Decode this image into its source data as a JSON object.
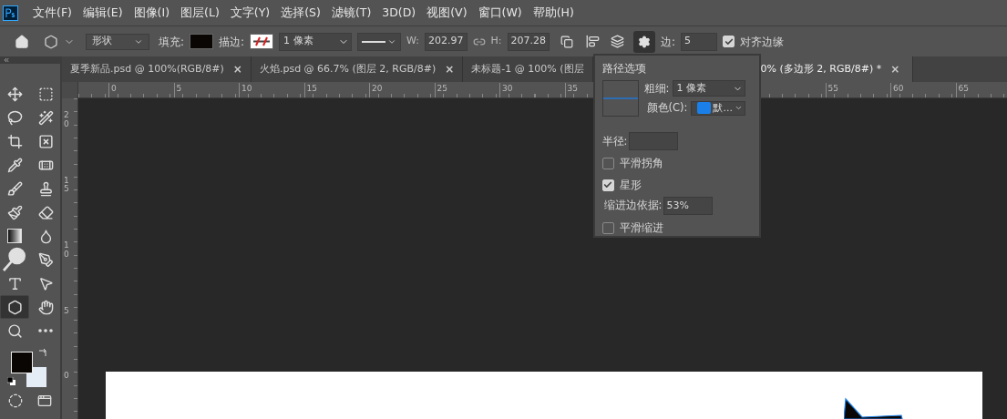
{
  "menu": [
    "文件(F)",
    "编辑(E)",
    "图像(I)",
    "图层(L)",
    "文字(Y)",
    "选择(S)",
    "滤镜(T)",
    "3D(D)",
    "视图(V)",
    "窗口(W)",
    "帮助(H)"
  ],
  "options_bar": {
    "mode": "形状",
    "fill_label": "填充:",
    "stroke_label": "描边:",
    "stroke_width": "1 像素",
    "w_label": "W:",
    "w_value": "202.97",
    "h_label": "H:",
    "h_value": "207.28",
    "sides_label": "边:",
    "sides_value": "5",
    "align_edges": {
      "label": "对齐边缘",
      "checked": true
    }
  },
  "tabs": [
    {
      "label": "夏季新品.psd @ 100%(RGB/8#)",
      "selected": false,
      "close": "×"
    },
    {
      "label": "火焰.psd @ 66.7% (图层 2, RGB/8#)",
      "selected": false,
      "close": "×"
    },
    {
      "label": "未标题-1 @ 100% (图层",
      "selected": false
    },
    {
      "label": "0% (多边形 2, RGB/8#) *",
      "selected": true,
      "close": "×"
    }
  ],
  "ruler_h": [
    "0",
    "5",
    "10",
    "15",
    "20",
    "25",
    "30",
    "35",
    "55",
    "60",
    "65"
  ],
  "ruler_v": [
    "20",
    "15",
    "10",
    "5",
    "0"
  ],
  "tools": [
    {
      "selected": false
    },
    {
      "selected": false
    },
    {
      "selected": false
    },
    {
      "selected": false
    },
    {
      "selected": false
    },
    {
      "selected": false
    },
    {
      "selected": false
    },
    {
      "selected": false
    },
    {
      "selected": false
    },
    {
      "selected": false
    },
    {
      "selected": false
    },
    {
      "selected": false
    },
    {
      "selected": false
    },
    {
      "selected": false
    },
    {
      "selected": false
    },
    {
      "selected": false
    },
    {
      "selected": false
    },
    {
      "selected": false
    },
    {
      "selected": true
    },
    {
      "selected": false
    },
    {
      "selected": false
    },
    {
      "selected": false
    }
  ],
  "path_options": {
    "title": "路径选项",
    "thickness_label": "粗细:",
    "thickness_value": "1 像素",
    "color_label": "颜色(C):",
    "color": "#1a7fe8",
    "color_value": "默...",
    "radius_label": "半径:",
    "checks": [
      {
        "kind": "checkbox",
        "label": "平滑拐角",
        "checked": false
      },
      {
        "kind": "checkbox",
        "label": "星形",
        "checked": true
      },
      {
        "kind": "field",
        "label": "缩进边依据:",
        "value": "53%"
      },
      {
        "kind": "checkbox",
        "label": "平滑缩进",
        "checked": false
      }
    ]
  }
}
